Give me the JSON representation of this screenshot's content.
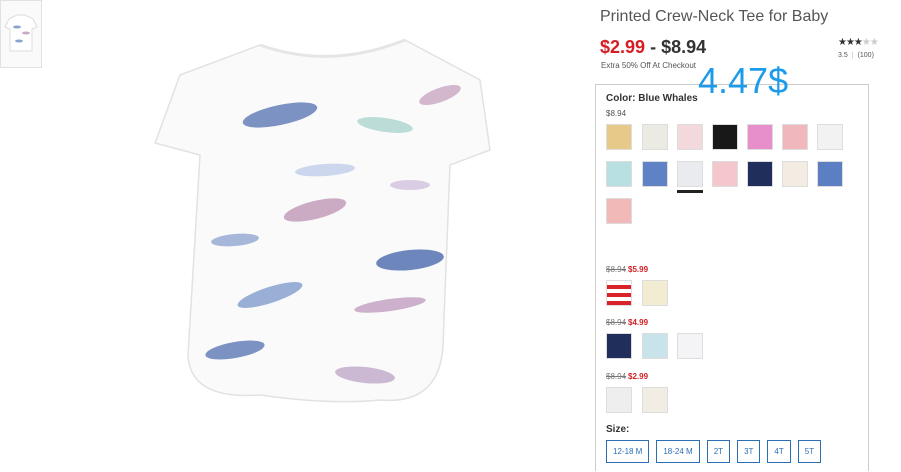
{
  "product": {
    "title": "Printed Crew-Neck Tee for Baby",
    "price_low": "$2.99",
    "price_sep": "-",
    "price_high": "$8.94",
    "promo": "Extra 50% Off At Checkout",
    "stars_on": "★★★",
    "stars_off": "★★",
    "rating_value": "3.5",
    "rating_sep": "|",
    "rating_count": "(100)",
    "overlay_price": "4.47$"
  },
  "color": {
    "label": "Color:",
    "selected": "Blue Whales",
    "group1_price": "$8.94",
    "group2_old": "$8.94",
    "group2_new": "$5.99",
    "group3_old": "$8.94",
    "group3_new": "$4.99",
    "group4_old": "$8.94",
    "group4_new": "$2.99"
  },
  "swatch_colors": {
    "group1": [
      "#e7c98a",
      "#ebeae3",
      "#f3d9dc",
      "#181818",
      "#e68fcb",
      "#f0b7bd",
      "#f2f2f2",
      "#b8e0e3",
      "#5f82c7",
      "#e9ebee",
      "#f4c7cd",
      "#1f2e5b",
      "#f2ece2",
      "#5c7fc4",
      "#f2b9b9"
    ],
    "group2": [
      "#d9232b",
      "#f2ecd3"
    ],
    "group3": [
      "#1f2e5b",
      "#c8e4ea",
      "#f4f4f6"
    ],
    "group4": [
      "#eeeeee",
      "#f1ece4"
    ]
  },
  "size": {
    "label": "Size:",
    "options": [
      "12-18 M",
      "18-24 M",
      "2T",
      "3T",
      "4T",
      "5T"
    ]
  }
}
